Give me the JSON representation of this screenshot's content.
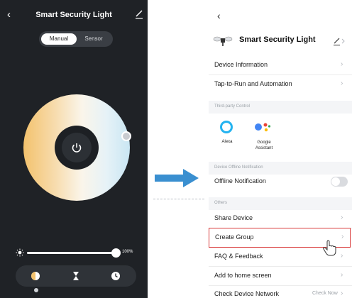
{
  "left": {
    "title": "Smart Security Light",
    "back_icon": "chevron-left-icon",
    "edit_icon": "pencil-icon",
    "mode_tabs": [
      "Manual",
      "Sensor"
    ],
    "selected_mode": "Manual",
    "brightness_value": "100%",
    "bottom_tabs": [
      "white-light-icon",
      "timer-icon",
      "schedule-icon"
    ]
  },
  "right": {
    "back_icon": "chevron-left-icon",
    "device_name": "Smart Security Light",
    "rows": {
      "device_info": "Device Information",
      "tap_to_run": "Tap-to-Run and Automation",
      "offline_notification": "Offline Notification",
      "share_device": "Share Device",
      "create_group": "Create Group",
      "faq": "FAQ & Feedback",
      "add_home": "Add to home screen",
      "check_network": "Check Device Network",
      "check_now": "Check Now"
    },
    "sections": {
      "third_party": "Third-party Control",
      "offline": "Device Offline Notification",
      "others": "Others"
    },
    "third_party": {
      "alexa": "Alexa",
      "google": "Google Assistant"
    },
    "offline_notification_enabled": false
  },
  "colors": {
    "left_bg": "#1f2226",
    "arrow": "#3a8fd0",
    "highlight_border": "#d93b3b"
  }
}
